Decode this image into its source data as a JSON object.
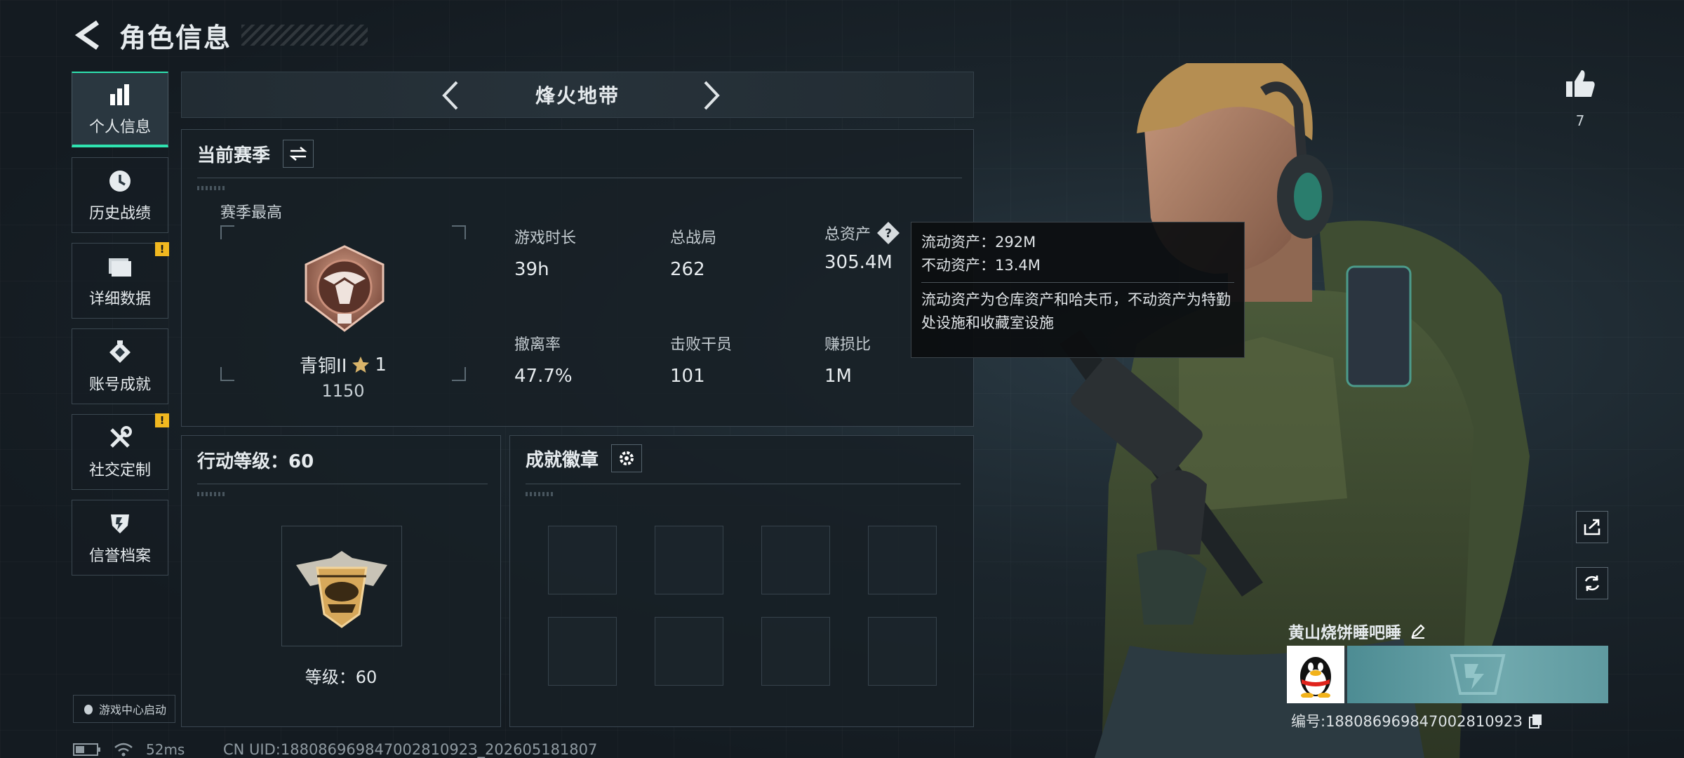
{
  "header": {
    "title": "角色信息"
  },
  "sidebar": {
    "items": [
      {
        "label": "个人信息",
        "icon": "bar-chart-icon",
        "active": true,
        "alert": false
      },
      {
        "label": "历史战绩",
        "icon": "history-icon",
        "active": false,
        "alert": false
      },
      {
        "label": "详细数据",
        "icon": "folder-icon",
        "active": false,
        "alert": true
      },
      {
        "label": "账号成就",
        "icon": "achievement-icon",
        "active": false,
        "alert": false
      },
      {
        "label": "社交定制",
        "icon": "tools-icon",
        "active": false,
        "alert": true
      },
      {
        "label": "信誉档案",
        "icon": "credit-shield-icon",
        "active": false,
        "alert": false
      }
    ],
    "alert_mark": "!",
    "game_center_label": "游戏中心启动"
  },
  "mode_bar": {
    "title": "烽火地带"
  },
  "season": {
    "title": "当前赛季",
    "best_label": "赛季最高",
    "rank_name": "青铜II",
    "rank_stars": "1",
    "rank_points": "1150",
    "stats": [
      {
        "key": "游戏时长",
        "value": "39h"
      },
      {
        "key": "总战局",
        "value": "262"
      },
      {
        "key": "总资产",
        "value": "305.4M"
      },
      {
        "key": "撤离率",
        "value": "47.7%"
      },
      {
        "key": "击败干员",
        "value": "101"
      },
      {
        "key": "赚损比",
        "value": "1M"
      }
    ],
    "help_mark": "?"
  },
  "tooltip": {
    "liquid": "流动资产：292M",
    "fixed": "不动资产：13.4M",
    "description": "流动资产为仓库资产和哈夫币，不动资产为特勤处设施和收藏室设施"
  },
  "action_level": {
    "title": "行动等级：60",
    "level_label": "等级：60"
  },
  "achievements": {
    "title": "成就徽章"
  },
  "profile": {
    "likes": "7",
    "player_name": "黄山烧饼睡吧睡",
    "player_id": "编号:18808696984700281092З"
  },
  "status_bar": {
    "ping": "52ms",
    "uid": "CN UID:18808696984700281092З_202605181807"
  },
  "colors": {
    "accent": "#2fe3b0",
    "alert": "#f1b820",
    "background": "#161d23"
  }
}
